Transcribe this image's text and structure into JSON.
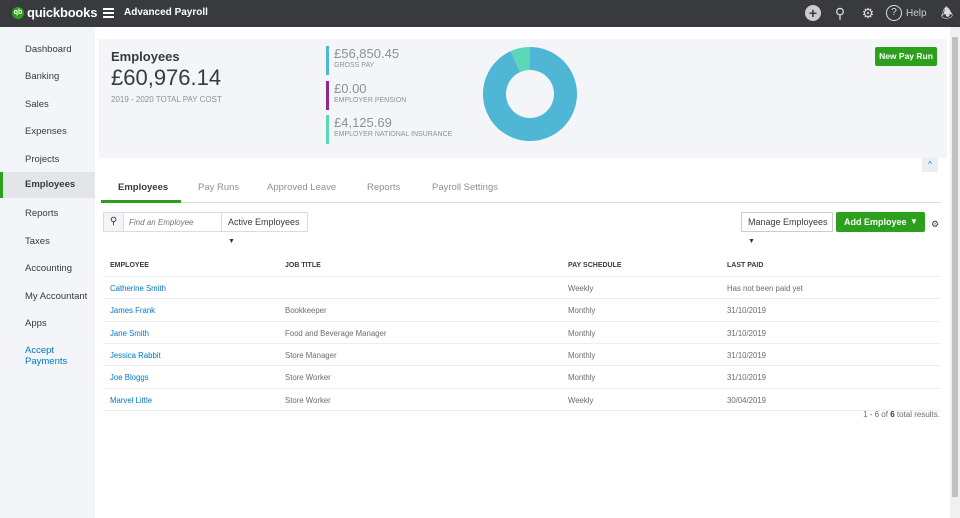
{
  "topbar": {
    "logo": "quickbooks",
    "logo_badge": "qb",
    "app_title": "Advanced Payroll",
    "help_label": "Help",
    "icons": [
      "plus-circle-icon",
      "search-icon",
      "gear-icon",
      "help-icon",
      "bell-icon"
    ]
  },
  "sidebar": {
    "items": [
      {
        "label": "Dashboard"
      },
      {
        "label": "Banking"
      },
      {
        "label": "Sales"
      },
      {
        "label": "Expenses"
      },
      {
        "label": "Projects"
      },
      {
        "label": "Employees",
        "active": true
      },
      {
        "label": "Reports"
      },
      {
        "label": "Taxes"
      },
      {
        "label": "Accounting"
      },
      {
        "label": "My Accountant"
      },
      {
        "label": "Apps"
      },
      {
        "label": "Accept Payments"
      }
    ]
  },
  "summary": {
    "title": "Employees",
    "total": "£60,976.14",
    "total_label": "2019 - 2020 TOTAL PAY COST",
    "stats": [
      {
        "value": "£56,850.45",
        "label": "GROSS PAY",
        "color": "#4fb6d6"
      },
      {
        "value": "£0.00",
        "label": "EMPLOYER PENSION",
        "color": "#8d2a8e"
      },
      {
        "value": "£4,125.69",
        "label": "EMPLOYER NATIONAL INSURANCE",
        "color": "#5ad7b6"
      }
    ],
    "donut_values": [
      56850.45,
      0,
      4125.69
    ],
    "new_pay_run": "New Pay Run"
  },
  "tabs": [
    {
      "label": "Employees",
      "active": true
    },
    {
      "label": "Pay Runs"
    },
    {
      "label": "Approved Leave"
    },
    {
      "label": "Reports"
    },
    {
      "label": "Payroll Settings"
    }
  ],
  "toolbar": {
    "search_placeholder": "Find an Employee",
    "filter": "Active Employees",
    "manage": "Manage Employees",
    "add": "Add Employee"
  },
  "table": {
    "headers": [
      "EMPLOYEE",
      "JOB TITLE",
      "PAY SCHEDULE",
      "LAST PAID"
    ],
    "rows": [
      [
        "Catherine Smith",
        "",
        "Weekly",
        "Has not been paid yet"
      ],
      [
        "James Frank",
        "Bookkeeper",
        "Monthly",
        "31/10/2019"
      ],
      [
        "Jane Smith",
        "Food and Beverage Manager",
        "Monthly",
        "31/10/2019"
      ],
      [
        "Jessica Rabbit",
        "Store Manager",
        "Monthly",
        "31/10/2019"
      ],
      [
        "Joe Bloggs",
        "Store Worker",
        "Monthly",
        "31/10/2019"
      ],
      [
        "Marvel Little",
        "Store Worker",
        "Weekly",
        "30/04/2019"
      ]
    ]
  },
  "footer": {
    "prefix": "1 - 6 of ",
    "count": "6",
    "suffix": " total results."
  }
}
